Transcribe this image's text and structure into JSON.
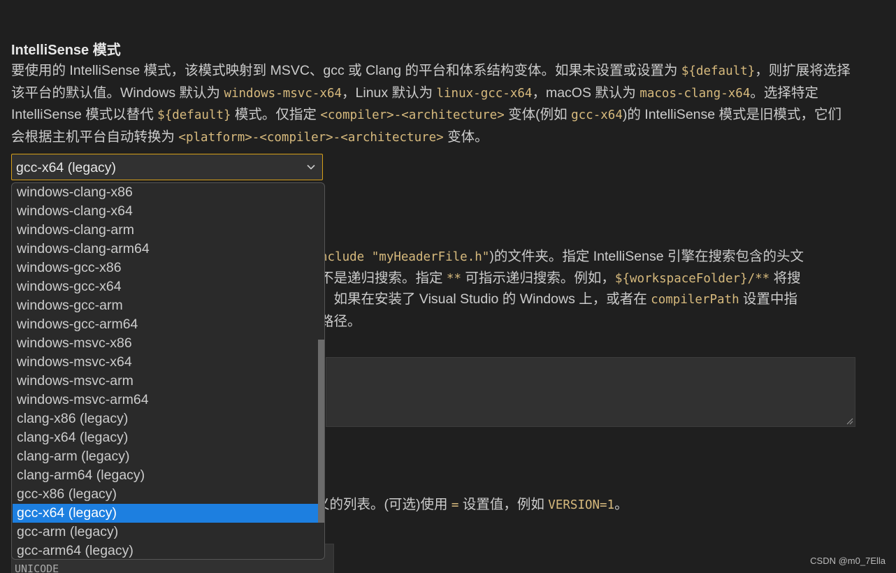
{
  "setting": {
    "title": "IntelliSense 模式",
    "desc": {
      "p1": "要使用的 IntelliSense 模式，该模式映射到 MSVC、gcc 或 Clang 的平台和体系结构变体。如果未设置或设置为 ",
      "c1": "${default}",
      "p2": "，则扩展将选择该平台的默认值。Windows 默认为 ",
      "c2": "windows-msvc-x64",
      "p3": "，Linux 默认为 ",
      "c3": "linux-gcc-x64",
      "p4": "，macOS 默认为 ",
      "c4": "macos-clang-x64",
      "p5": "。选择特定 IntelliSense 模式以替代 ",
      "c5": "${default}",
      "p6": " 模式。仅指定 ",
      "c6": "<compiler>-<architecture>",
      "p7": " 变体(例如 ",
      "c7": "gcc-x64",
      "p8": ")的 IntelliSense 模式是旧模式，它们会根据主机平台自动转换为 ",
      "c8": "<platform>-<compiler>-<architecture>",
      "p9": " 变体。"
    }
  },
  "select": {
    "value": "gcc-x64 (legacy)",
    "options": [
      "windows-clang-x86",
      "windows-clang-x64",
      "windows-clang-arm",
      "windows-clang-arm64",
      "windows-gcc-x86",
      "windows-gcc-x64",
      "windows-gcc-arm",
      "windows-gcc-arm64",
      "windows-msvc-x86",
      "windows-msvc-x64",
      "windows-msvc-arm",
      "windows-msvc-arm64",
      "clang-x86 (legacy)",
      "clang-x64 (legacy)",
      "clang-arm (legacy)",
      "clang-arm64 (legacy)",
      "gcc-x86 (legacy)",
      "gcc-x64 (legacy)",
      "gcc-arm (legacy)",
      "gcc-arm64 (legacy)"
    ],
    "selected_index": 17
  },
  "include_setting": {
    "l1_code": "nclude \"myHeaderFile.h\"",
    "l1_text": ")的文件夹。指定 IntelliSense 引擎在搜索包含的头文",
    "l2_text_a": "不是递归搜索。指定 ",
    "l2_code_a": "**",
    "l2_text_b": " 可指示递归搜索。例如，",
    "l2_code_b": "${workspaceFolder}/**",
    "l2_text_c": " 将搜",
    "l3_text_a": "。如果在安装了 Visual Studio 的 Windows 上，或者在 ",
    "l3_code": "compilerPath",
    "l3_text_b": " 设置中指",
    "l4_text": " 路径。"
  },
  "defines_setting": {
    "text_a": "义的列表。(可选)使用 ",
    "code_a": "=",
    "text_b": " 设置值，例如 ",
    "code_b": "VERSION=1",
    "text_c": "。",
    "input_value": "UNICODE"
  },
  "watermark": "CSDN @m0_7Ella",
  "colors": {
    "background": "#1f1f1f",
    "code": "#d7ba7d",
    "focus_border": "#d69f19",
    "selection": "#1d7fe0"
  }
}
